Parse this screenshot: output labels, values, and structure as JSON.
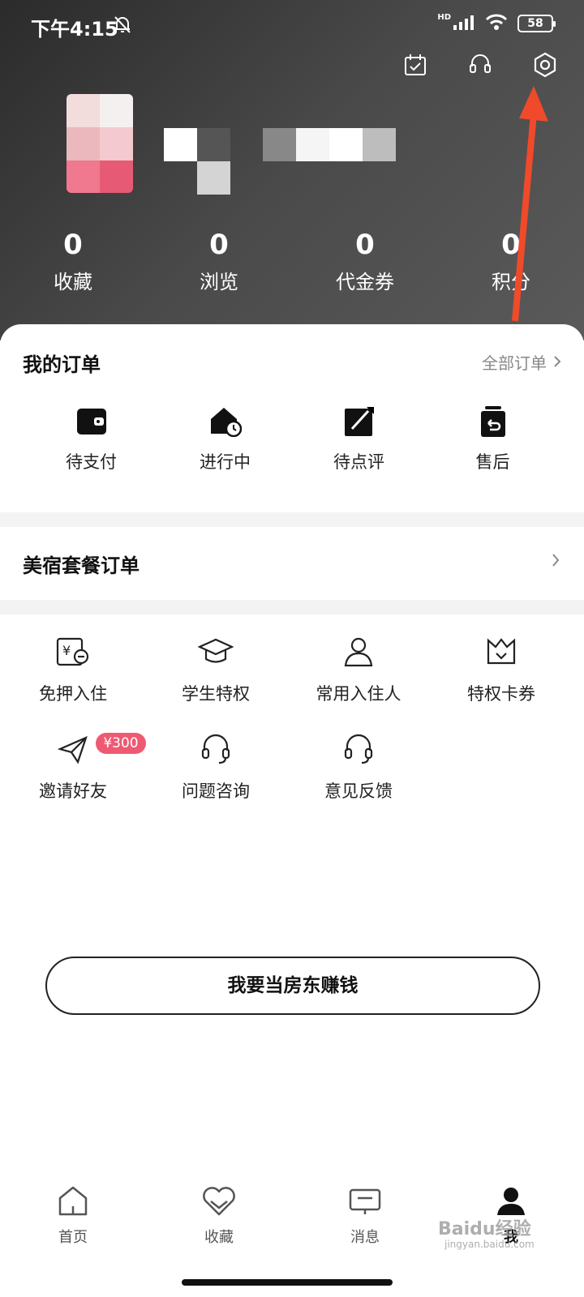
{
  "status_bar": {
    "time": "下午4:15",
    "hd": "HD",
    "battery": "58"
  },
  "stats": [
    {
      "value": "0",
      "label": "收藏"
    },
    {
      "value": "0",
      "label": "浏览"
    },
    {
      "value": "0",
      "label": "代金券"
    },
    {
      "value": "0",
      "label": "积分"
    }
  ],
  "orders": {
    "title": "我的订单",
    "all_label": "全部订单",
    "items": [
      {
        "label": "待支付",
        "icon": "wallet-icon"
      },
      {
        "label": "进行中",
        "icon": "house-clock-icon"
      },
      {
        "label": "待点评",
        "icon": "edit-icon"
      },
      {
        "label": "售后",
        "icon": "return-icon"
      }
    ]
  },
  "package": {
    "title": "美宿套餐订单"
  },
  "services": [
    {
      "label": "免押入住",
      "icon": "deposit-free-icon"
    },
    {
      "label": "学生特权",
      "icon": "graduation-cap-icon"
    },
    {
      "label": "常用入住人",
      "icon": "person-icon"
    },
    {
      "label": "特权卡券",
      "icon": "crown-card-icon"
    },
    {
      "label": "邀请好友",
      "icon": "paper-plane-icon"
    },
    {
      "label": "问题咨询",
      "icon": "headset-icon"
    },
    {
      "label": "意见反馈",
      "icon": "headset-icon"
    }
  ],
  "invite_badge": "¥300",
  "landlord_button": "我要当房东赚钱",
  "bottom_nav": [
    {
      "label": "首页",
      "icon": "home-icon"
    },
    {
      "label": "收藏",
      "icon": "heart-icon"
    },
    {
      "label": "消息",
      "icon": "message-icon"
    },
    {
      "label": "我",
      "icon": "user-icon"
    }
  ],
  "watermark": {
    "brand": "Baidu经验",
    "url": "jingyan.baidu.com"
  },
  "colors": {
    "accent": "#ef5a73",
    "arrow": "#f04a2a"
  }
}
